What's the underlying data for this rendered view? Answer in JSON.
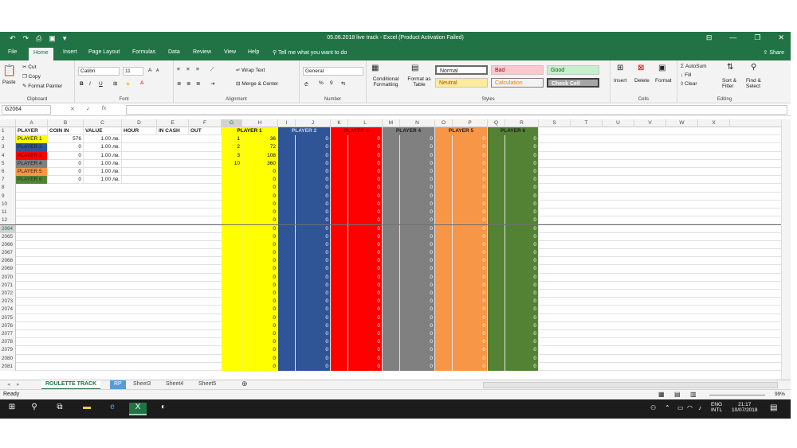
{
  "window": {
    "title": "05.06.2018 live track - Excel (Product Activation Failed)"
  },
  "qat": {
    "undo": "↶",
    "redo": "↷",
    "preview": "⎙",
    "save": "▣",
    "more": "▾"
  },
  "window_controls": {
    "ribbon_opts": "⊟",
    "minimize": "—",
    "restore": "❐",
    "close": "✕"
  },
  "tabs": [
    "File",
    "Home",
    "Insert",
    "Page Layout",
    "Formulas",
    "Data",
    "Review",
    "View",
    "Help"
  ],
  "tell_me": "Tell me what you want to do",
  "share": "Share",
  "ribbon": {
    "clipboard": {
      "paste": "Paste",
      "cut": "Cut",
      "copy": "Copy",
      "format_painter": "Format Painter",
      "label": "Clipboard"
    },
    "font": {
      "name": "Calibri",
      "size": "11",
      "bold": "B",
      "italic": "I",
      "underline": "U",
      "label": "Font",
      "grow": "A",
      "shrink": "A"
    },
    "alignment": {
      "wrap": "Wrap Text",
      "merge": "Merge & Center",
      "label": "Alignment"
    },
    "number": {
      "format": "General",
      "label": "Number",
      "percent": "%",
      "comma": "9"
    },
    "styles": {
      "cond": "Conditional Formatting",
      "table": "Format as Table",
      "normal": "Normal",
      "bad": "Bad",
      "good": "Good",
      "neutral": "Neutral",
      "calculation": "Calculation",
      "check": "Check Cell",
      "label": "Styles"
    },
    "cells": {
      "insert": "Insert",
      "delete": "Delete",
      "format": "Format",
      "label": "Cells"
    },
    "editing": {
      "autosum": "AutoSum",
      "fill": "Fill",
      "clear": "Clear",
      "sort": "Sort & Filter",
      "find": "Find & Select",
      "label": "Editing"
    }
  },
  "formula_bar": {
    "name_box": "G2064",
    "fx": "fx",
    "value": ""
  },
  "columns": [
    "A",
    "B",
    "C",
    "D",
    "E",
    "F",
    "G",
    "H",
    "I",
    "J",
    "K",
    "L",
    "M",
    "N",
    "O",
    "P",
    "Q",
    "R",
    "S",
    "T",
    "U",
    "V",
    "W",
    "X"
  ],
  "header_row": {
    "player": "PLAYER",
    "coin_in": "COIN IN",
    "value": "VALUE",
    "hour": "HOUR",
    "in_cash": "IN CASH",
    "out": "OUT"
  },
  "player_colors": {
    "p1": "#ffff00",
    "p2": "#2f5597",
    "p3": "#ff0000",
    "p4": "#808080",
    "p5": "#f79646",
    "p6": "#548235"
  },
  "players": [
    {
      "name": "PLAYER 1",
      "coin": "576",
      "value": "1.00 лв."
    },
    {
      "name": "PLAYER 2",
      "coin": "0",
      "value": "1.00 лв."
    },
    {
      "name": "PLAYER 3",
      "coin": "0",
      "value": "1.00 лв."
    },
    {
      "name": "PLAYER 4",
      "coin": "0",
      "value": "1.00 лв."
    },
    {
      "name": "PLAYER 5",
      "coin": "0",
      "value": "1.00 лв."
    },
    {
      "name": "PLAYER 6",
      "coin": "0",
      "value": "1.00 лв."
    }
  ],
  "track_headers": [
    "PLAYER 1",
    "PLAYER 2",
    "PLAYER 3",
    "PLAYER 4",
    "PLAYER 5",
    "PLAYER 6"
  ],
  "p1_track": [
    {
      "g": "1",
      "h": "36"
    },
    {
      "g": "2",
      "h": "72"
    },
    {
      "g": "3",
      "h": "108"
    },
    {
      "g": "10",
      "h": "360"
    }
  ],
  "row_numbers": [
    "1",
    "2",
    "3",
    "4",
    "5",
    "6",
    "7",
    "8",
    "9",
    "10",
    "11",
    "12",
    "2064",
    "2065",
    "2066",
    "2067",
    "2068",
    "2069",
    "2070",
    "2071",
    "2072",
    "2073",
    "2074",
    "2075",
    "2076",
    "2077",
    "2078",
    "2079",
    "2080",
    "2081"
  ],
  "zero": "0",
  "sheet_tabs": [
    "ROULETTE TRACK",
    "RP",
    "Sheet3",
    "Sheet4",
    "Sheet5"
  ],
  "status": {
    "ready": "Ready",
    "zoom": "99%"
  },
  "taskbar": {
    "lang": "ENG",
    "layout": "INTL",
    "time": "21:17",
    "date": "10/07/2018"
  }
}
